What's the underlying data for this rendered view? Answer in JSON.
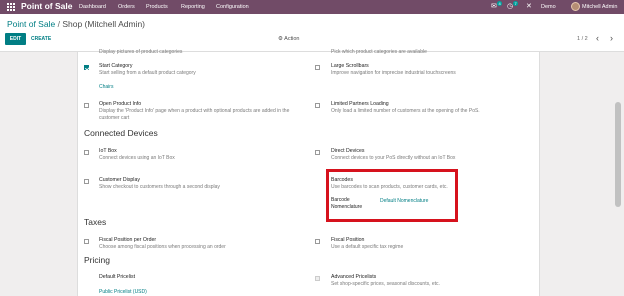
{
  "topnav": {
    "app_name": "Point of Sale",
    "menus": [
      "Dashboard",
      "Orders",
      "Products",
      "Reporting",
      "Configuration"
    ],
    "chat_badge": "4",
    "activity_badge": "7",
    "company": "Demo",
    "user": "Mitchell Admin"
  },
  "controlpanel": {
    "breadcrumb_parent": "Point of Sale",
    "breadcrumb_sep": "/",
    "breadcrumb_current": "Shop (Mitchell Admin)",
    "edit_label": "EDIT",
    "create_label": "CREATE",
    "action_label": "Action",
    "pager": "1 / 2"
  },
  "settings": {
    "top_left_desc": "Display pictures of product categories",
    "top_right_desc": "Pick which product categories are available",
    "start_category": {
      "title": "Start Category",
      "desc": "Start selling from a default product category",
      "value": "Chairs",
      "checked": true
    },
    "large_scrollbars": {
      "title": "Large Scrollbars",
      "desc": "Improve navigation for imprecise industrial touchscreens",
      "checked": false
    },
    "open_product_info": {
      "title": "Open Product Info",
      "desc1": "Display the 'Product Info' page when a product with optional products are added in the",
      "desc2": "customer cart",
      "checked": false
    },
    "limited_partners": {
      "title": "Limited Partners Loading",
      "desc": "Only load a limited number of customers at the opening of the PoS.",
      "checked": false
    },
    "connected_devices_heading": "Connected Devices",
    "iot_box": {
      "title": "IoT Box",
      "desc": "Connect devices using an IoT Box",
      "checked": false
    },
    "direct_devices": {
      "title": "Direct Devices",
      "desc": "Connect devices to your PoS directly without an IoT Box",
      "checked": false
    },
    "customer_display": {
      "title": "Customer Display",
      "desc": "Show checkout to customers through a second display",
      "checked": false
    },
    "barcodes": {
      "title": "Barcodes",
      "desc": "Use barcodes to scan products, customer cards, etc.",
      "field_label_1": "Barcode",
      "field_label_2": "Nomenclature",
      "field_value": "Default Nomenclature"
    },
    "taxes_heading": "Taxes",
    "fiscal_position_per_order": {
      "title": "Fiscal Position per Order",
      "desc": "Choose among fiscal positions when processing an order",
      "checked": false
    },
    "fiscal_position": {
      "title": "Fiscal Position",
      "desc": "Use a default specific tax regime",
      "checked": false
    },
    "pricing_heading": "Pricing",
    "default_pricelist": {
      "title": "Default Pricelist",
      "value": "Public Pricelist (USD)"
    },
    "advanced_pricelists": {
      "title": "Advanced Pricelists",
      "desc": "Set shop-specific prices, seasonal discounts, etc.",
      "checked": false
    }
  },
  "colors": {
    "brand": "#714b67",
    "accent": "#017e84",
    "highlight": "#d6121d"
  }
}
